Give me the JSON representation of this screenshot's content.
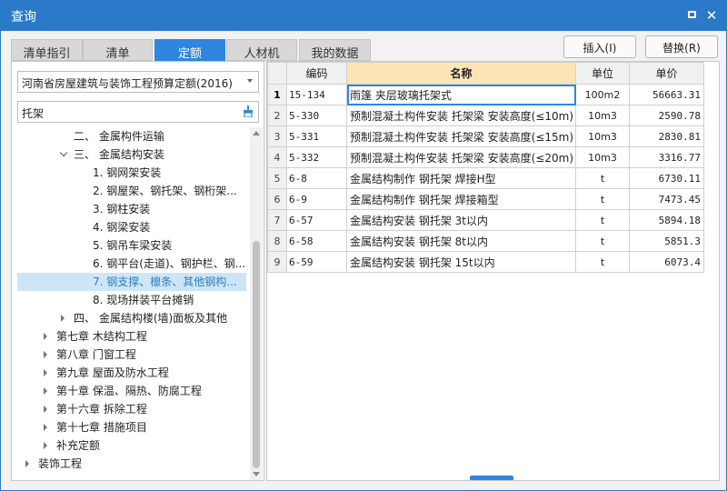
{
  "window": {
    "title": "查询"
  },
  "tabs": [
    {
      "label": "清单指引",
      "active": false
    },
    {
      "label": "清单",
      "active": false
    },
    {
      "label": "定额",
      "active": true
    },
    {
      "label": "人材机",
      "active": false
    },
    {
      "label": "我的数据",
      "active": false
    }
  ],
  "actions": {
    "insert": "插入(I)",
    "replace": "替换(R)"
  },
  "left": {
    "quota_library": "河南省房屋建筑与装饰工程预算定额(2016)",
    "search_value": "托架",
    "tree": [
      {
        "label": "二、 金属构件运输",
        "level": 2,
        "toggle": "none"
      },
      {
        "label": "三、 金属结构安装",
        "level": 2,
        "toggle": "expanded"
      },
      {
        "label": "1. 钢网架安装",
        "level": 3,
        "toggle": "none"
      },
      {
        "label": "2. 钢屋架、钢托架、钢桁架...",
        "level": 3,
        "toggle": "none"
      },
      {
        "label": "3. 钢柱安装",
        "level": 3,
        "toggle": "none"
      },
      {
        "label": "4. 钢梁安装",
        "level": 3,
        "toggle": "none"
      },
      {
        "label": "5. 钢吊车梁安装",
        "level": 3,
        "toggle": "none"
      },
      {
        "label": "6. 钢平台(走道)、钢护栏、钢...",
        "level": 3,
        "toggle": "none"
      },
      {
        "label": "7. 钢支撑、檩条、其他钢构...",
        "level": 3,
        "toggle": "none",
        "selected": true
      },
      {
        "label": "8. 现场拼装平台摊销",
        "level": 3,
        "toggle": "none"
      },
      {
        "label": "四、 金属结构楼(墙)面板及其他",
        "level": 2,
        "toggle": "collapsed"
      },
      {
        "label": "第七章 木结构工程",
        "level": 1,
        "toggle": "collapsed"
      },
      {
        "label": "第八章 门窗工程",
        "level": 1,
        "toggle": "collapsed"
      },
      {
        "label": "第九章 屋面及防水工程",
        "level": 1,
        "toggle": "collapsed"
      },
      {
        "label": "第十章 保温、隔热、防腐工程",
        "level": 1,
        "toggle": "collapsed"
      },
      {
        "label": "第十六章 拆除工程",
        "level": 1,
        "toggle": "collapsed"
      },
      {
        "label": "第十七章 措施项目",
        "level": 1,
        "toggle": "collapsed"
      },
      {
        "label": "补充定额",
        "level": 1,
        "toggle": "collapsed"
      },
      {
        "label": "装饰工程",
        "level": 0,
        "toggle": "collapsed"
      }
    ]
  },
  "table": {
    "headers": [
      "",
      "编码",
      "名称",
      "单位",
      "单价"
    ],
    "rows": [
      {
        "n": "1",
        "code": "15-134",
        "name": "雨篷 夹层玻璃托架式",
        "unit": "100m2",
        "price": "56663.31"
      },
      {
        "n": "2",
        "code": "5-330",
        "name": "预制混凝土构件安装 托架梁 安装高度(≤10m)",
        "unit": "10m3",
        "price": "2590.78"
      },
      {
        "n": "3",
        "code": "5-331",
        "name": "预制混凝土构件安装 托架梁 安装高度(≤15m)",
        "unit": "10m3",
        "price": "2830.81"
      },
      {
        "n": "4",
        "code": "5-332",
        "name": "预制混凝土构件安装 托架梁 安装高度(≤20m)",
        "unit": "10m3",
        "price": "3316.77"
      },
      {
        "n": "5",
        "code": "6-8",
        "name": "金属结构制作 钢托架 焊接H型",
        "unit": "t",
        "price": "6730.11"
      },
      {
        "n": "6",
        "code": "6-9",
        "name": "金属结构制作 钢托架 焊接箱型",
        "unit": "t",
        "price": "7473.45"
      },
      {
        "n": "7",
        "code": "6-57",
        "name": "金属结构安装 钢托架 3t以内",
        "unit": "t",
        "price": "5894.18"
      },
      {
        "n": "8",
        "code": "6-58",
        "name": "金属结构安装 钢托架 8t以内",
        "unit": "t",
        "price": "5851.3"
      },
      {
        "n": "9",
        "code": "6-59",
        "name": "金属结构安装 钢托架 15t以内",
        "unit": "t",
        "price": "6073.4"
      }
    ]
  },
  "colors": {
    "titlebar": "#2b7ac9",
    "accent": "#2e86de",
    "name_header": "#fde4b5",
    "selection": "#cde6f7"
  }
}
